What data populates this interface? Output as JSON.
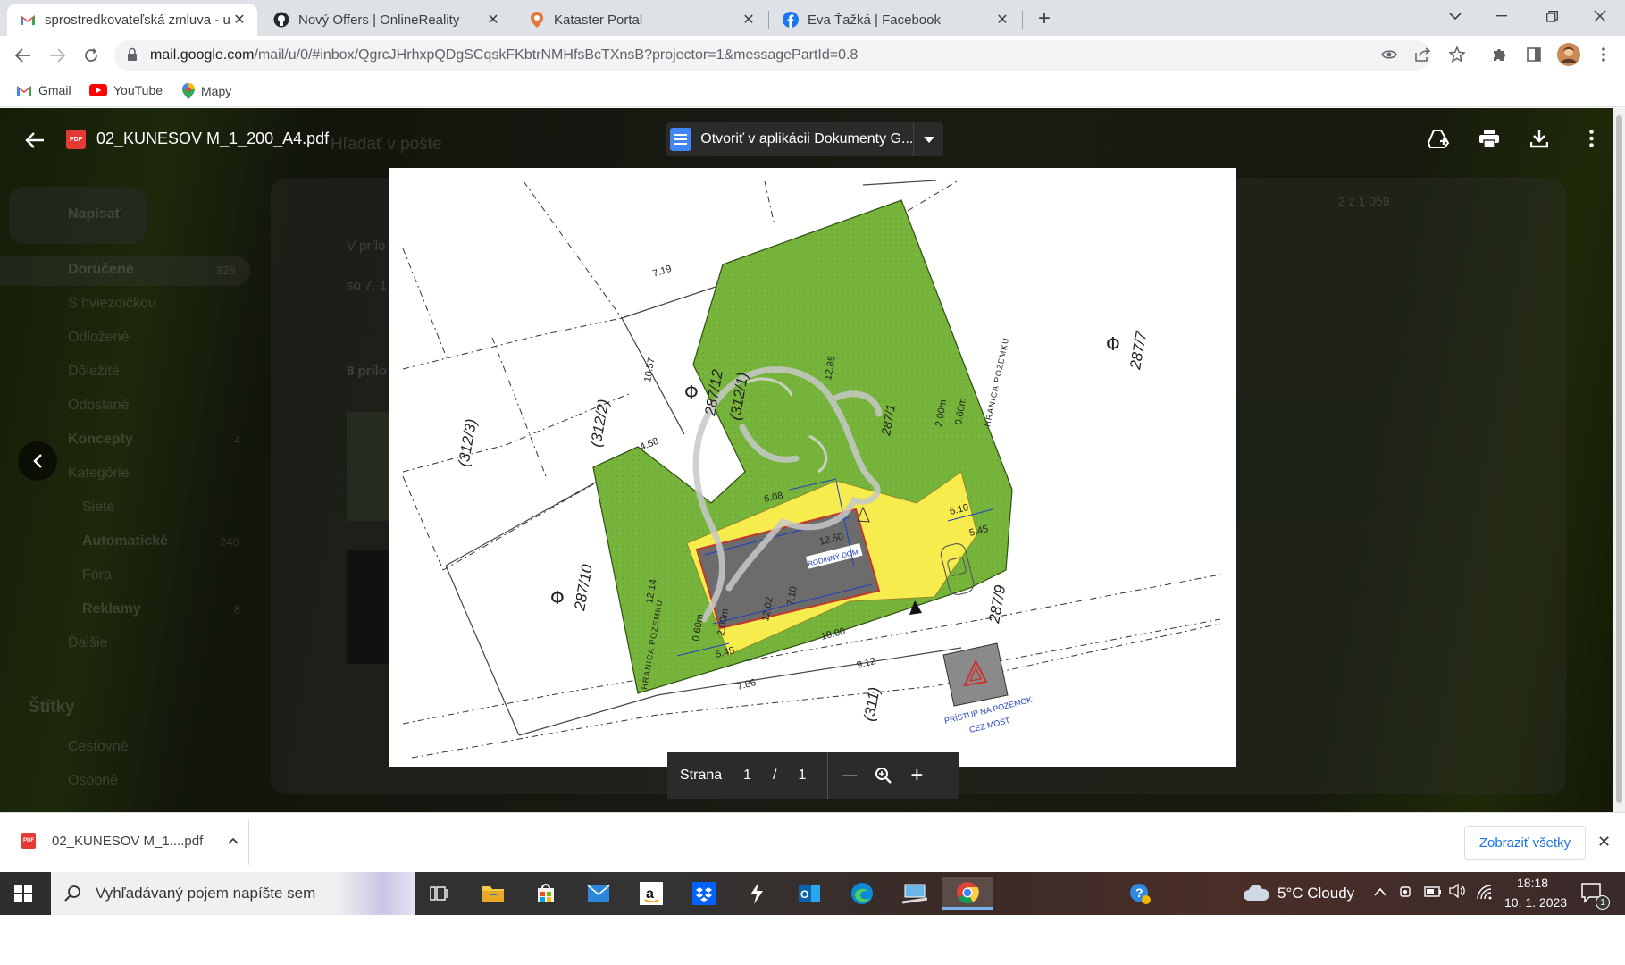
{
  "browser": {
    "tabs": [
      {
        "title": "sprostredkovateľská zmluva - ulb",
        "icon": "gmail-icon",
        "active": true
      },
      {
        "title": "Nový Offers | OnlineReality",
        "icon": "github-icon",
        "active": false
      },
      {
        "title": "Kataster Portal",
        "icon": "kataster-icon",
        "active": false
      },
      {
        "title": "Eva Ťažká | Facebook",
        "icon": "facebook-icon",
        "active": false
      }
    ],
    "new_tab": "+",
    "url_host": "mail.google.com",
    "url_path": "/mail/u/0/#inbox/QgrcJHrhxpQDgSCqskFKbtrNMHfsBcTXnsB?projector=1&messagePartId=0.8",
    "bookmarks": [
      {
        "label": "Gmail",
        "icon": "gmail-icon"
      },
      {
        "label": "YouTube",
        "icon": "youtube-icon"
      },
      {
        "label": "Mapy",
        "icon": "maps-pin-icon"
      }
    ]
  },
  "gmail_background": {
    "compose": "Napísať",
    "search_placeholder": "Hľadať v pošte",
    "nav": [
      {
        "label": "Doručené",
        "count": "328",
        "bold": true
      },
      {
        "label": "S hviezdičkou",
        "count": ""
      },
      {
        "label": "Odložené",
        "count": ""
      },
      {
        "label": "Dôležité",
        "count": ""
      },
      {
        "label": "Odoslané",
        "count": ""
      },
      {
        "label": "Koncepty",
        "count": "4",
        "bold": true
      },
      {
        "label": "Kategórie",
        "count": ""
      },
      {
        "label": "Siete",
        "count": ""
      },
      {
        "label": "Automatické",
        "count": "246",
        "bold": true
      },
      {
        "label": "Fóra",
        "count": ""
      },
      {
        "label": "Reklamy",
        "count": "8",
        "bold": true
      },
      {
        "label": "Ďalšie",
        "count": ""
      }
    ],
    "labels_heading": "Štítky",
    "labels": [
      "Cestovné",
      "Osobné"
    ],
    "message_snippet_1": "V prílo",
    "message_snippet_2": "so 7. 1",
    "attachments_heading": "8 prílo",
    "pager_text": "2 z 1 059"
  },
  "viewer": {
    "file_name": "02_KUNESOV M_1_200_A4.pdf",
    "open_with": "Otvoriť v aplikácii Dokumenty G...",
    "page_label": "Strana",
    "page_current": "1",
    "page_sep": "/",
    "page_total": "1",
    "zoom_out": "—",
    "zoom_in": "+"
  },
  "drawing": {
    "parcels": [
      "(312/3)",
      "(312/2)",
      "287/12",
      "(312/1)",
      "287/10",
      "287/7",
      "287/9",
      "(311)",
      "287/1"
    ],
    "dims": [
      "7.19",
      "10.57",
      "4.58",
      "6.08",
      "12.50",
      "10.00",
      "7.10",
      "12.02",
      "12.14",
      "5.45",
      "7.86",
      "9.12",
      "6.10",
      "5.45",
      "0.60m",
      "2.00m",
      "2.00m",
      "0.60m",
      "12.85"
    ],
    "edge_left": "HRANICA POZEMKU",
    "edge_right": "HRANICA POZEMKU",
    "house_label": "RODINNÝ DOM",
    "access_1": "PRÍSTUP NA POZEMOK",
    "access_2": "CEZ MOST"
  },
  "downloads": {
    "file": "02_KUNESOV M_1....pdf",
    "show_all": "Zobraziť všetky",
    "close": "✕"
  },
  "taskbar": {
    "search_placeholder": "Vyhľadávaný pojem napíšte sem",
    "weather": "5°C  Cloudy",
    "time": "18:18",
    "date": "10. 1. 2023",
    "notif_count": "1"
  }
}
